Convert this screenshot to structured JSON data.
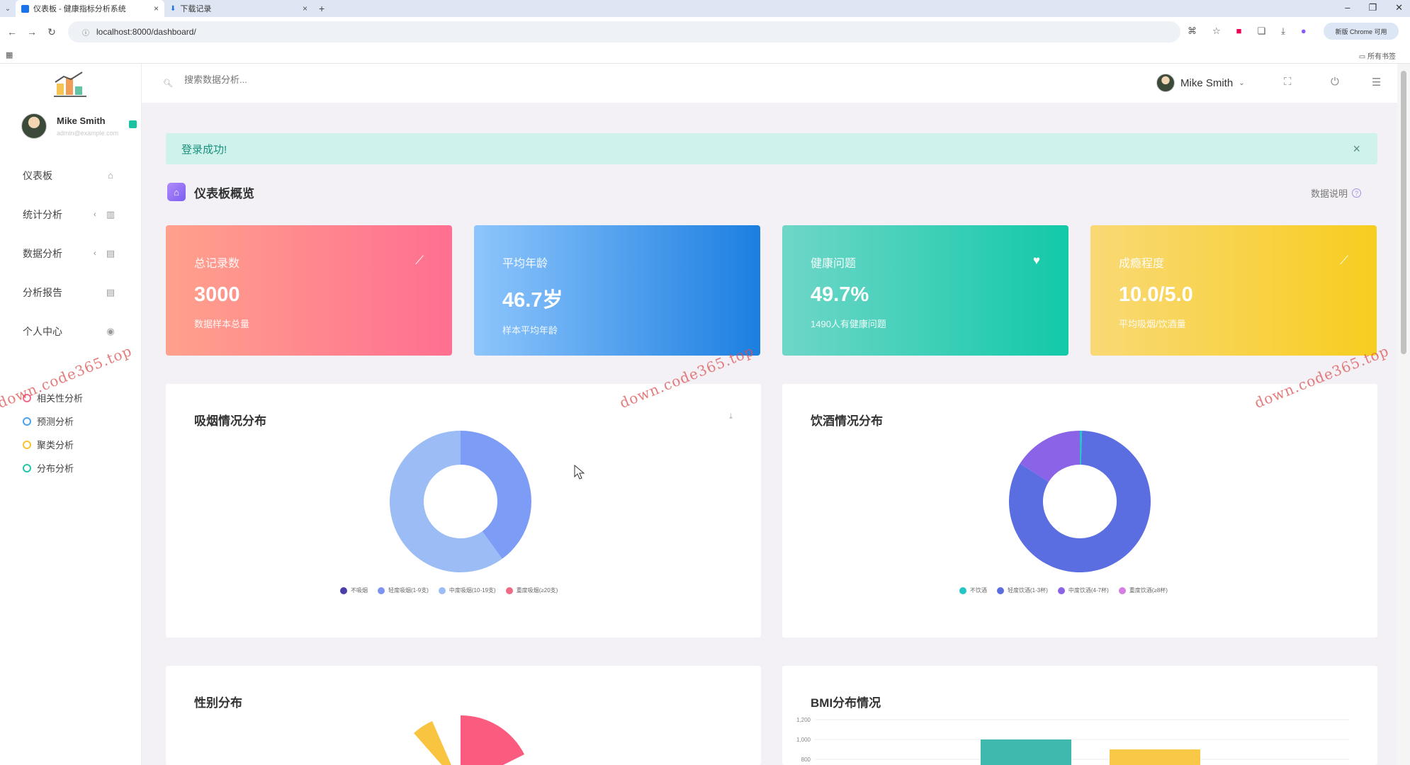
{
  "browser": {
    "tabs": [
      {
        "label": "仪表板 - 健康指标分析系统",
        "active": true
      },
      {
        "label": "下载记录",
        "active": false
      }
    ],
    "new_tab": "+",
    "url": "localhost:8000/dashboard/",
    "profile_label": "新版 Chrome 可用",
    "bookmarks_right": "所有书签"
  },
  "sidebar": {
    "user": {
      "name": "Mike Smith",
      "email": "admin@example.com"
    },
    "menu": [
      {
        "label": "仪表板",
        "icon": "home-icon",
        "glyph": "⌂",
        "arrow": ""
      },
      {
        "label": "统计分析",
        "icon": "bar-chart-icon",
        "glyph": "▥",
        "arrow": "‹"
      },
      {
        "label": "数据分析",
        "icon": "bar-chart-icon",
        "glyph": "▤",
        "arrow": "‹"
      },
      {
        "label": "分析报告",
        "icon": "document-icon",
        "glyph": "▤",
        "arrow": ""
      },
      {
        "label": "个人中心",
        "icon": "user-icon",
        "glyph": "◉",
        "arrow": ""
      }
    ],
    "submenu": [
      {
        "label": "相关性分析",
        "color": "#f06a8a"
      },
      {
        "label": "预测分析",
        "color": "#4aa3f0"
      },
      {
        "label": "聚类分析",
        "color": "#f5c232"
      },
      {
        "label": "分布分析",
        "color": "#23c6a7"
      }
    ]
  },
  "topbar": {
    "search_placeholder": "搜索数据分析...",
    "user_name": "Mike Smith"
  },
  "alert": {
    "message": "登录成功!",
    "close": "×"
  },
  "section": {
    "title": "仪表板概览",
    "right_label": "数据说明",
    "help": "?"
  },
  "stats": [
    {
      "label": "总记录数",
      "value": "3000",
      "sub": "数据样本总量",
      "icon": "line-chart-icon",
      "glyph": "⟋"
    },
    {
      "label": "平均年龄",
      "value": "46.7岁",
      "sub": "样本平均年龄",
      "icon": "user-icon",
      "glyph": ""
    },
    {
      "label": "健康问题",
      "value": "49.7%",
      "sub": "1490人有健康问题",
      "icon": "heart-icon",
      "glyph": "♥"
    },
    {
      "label": "成瘾程度",
      "value": "10.0/5.0",
      "sub": "平均吸烟/饮酒量",
      "icon": "trend-icon",
      "glyph": "⟋"
    }
  ],
  "panels": {
    "smoking": {
      "title": "吸烟情况分布",
      "legend": [
        {
          "label": "不吸烟",
          "color": "#4a3fa8"
        },
        {
          "label": "轻度吸烟(1-9支)",
          "color": "#7d93f2"
        },
        {
          "label": "中度吸烟(10-19支)",
          "color": "#9cbcf6"
        },
        {
          "label": "重度吸烟(≥20支)",
          "color": "#ee6b86"
        }
      ]
    },
    "drinking": {
      "title": "饮酒情况分布",
      "legend": [
        {
          "label": "不饮酒",
          "color": "#23c6c6"
        },
        {
          "label": "轻度饮酒(1-3杯)",
          "color": "#5b6ee1"
        },
        {
          "label": "中度饮酒(4-7杯)",
          "color": "#8a63e6"
        },
        {
          "label": "重度饮酒(≥8杯)",
          "color": "#d47ee6"
        }
      ]
    },
    "gender": {
      "title": "性别分布"
    },
    "bmi": {
      "title": "BMI分布情况",
      "yticks": [
        "1,200",
        "1,000",
        "800"
      ]
    }
  },
  "chart_data": [
    {
      "type": "pie",
      "title": "吸烟情况分布",
      "categories": [
        "不吸烟",
        "轻度吸烟(1-9支)",
        "中度吸烟(10-19支)",
        "重度吸烟(≥20支)"
      ],
      "values": [
        0,
        40,
        60,
        0
      ]
    },
    {
      "type": "pie",
      "title": "饮酒情况分布",
      "categories": [
        "不饮酒",
        "轻度饮酒(1-3杯)",
        "中度饮酒(4-7杯)",
        "重度饮酒(≥8杯)"
      ],
      "values": [
        0.5,
        83.5,
        16,
        0
      ]
    },
    {
      "type": "bar",
      "title": "BMI分布情况",
      "categories": [
        "",
        ""
      ],
      "values": [
        1000,
        900
      ],
      "ylim": [
        800,
        1200
      ]
    }
  ],
  "watermark": "down.code365.top"
}
